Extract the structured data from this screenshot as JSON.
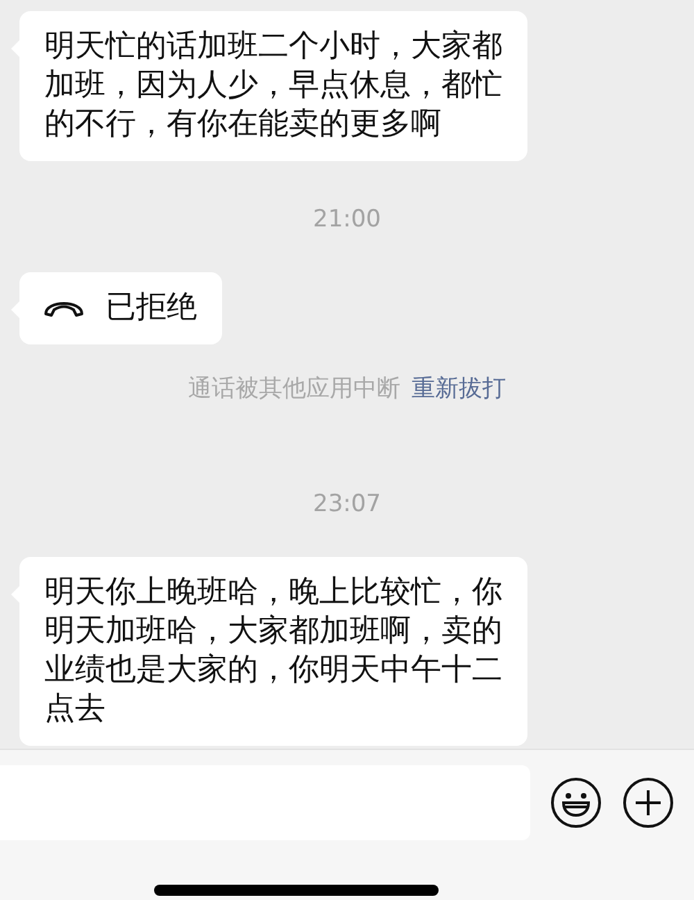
{
  "messages": [
    {
      "kind": "text",
      "text": "明天忙的话加班二个小时，大家都加班，因为人少，早点休息，都忙的不行，有你在能卖的更多啊"
    },
    {
      "kind": "time",
      "text": "21:00"
    },
    {
      "kind": "call",
      "text": "已拒绝"
    },
    {
      "kind": "notice",
      "text": "通话被其他应用中断",
      "link": "重新拔打"
    },
    {
      "kind": "time",
      "text": "23:07"
    },
    {
      "kind": "text",
      "text": "明天你上晚班哈，晚上比较忙，你明天加班哈，大家都加班啊，卖的业绩也是大家的，你明天中午十二点去"
    }
  ]
}
